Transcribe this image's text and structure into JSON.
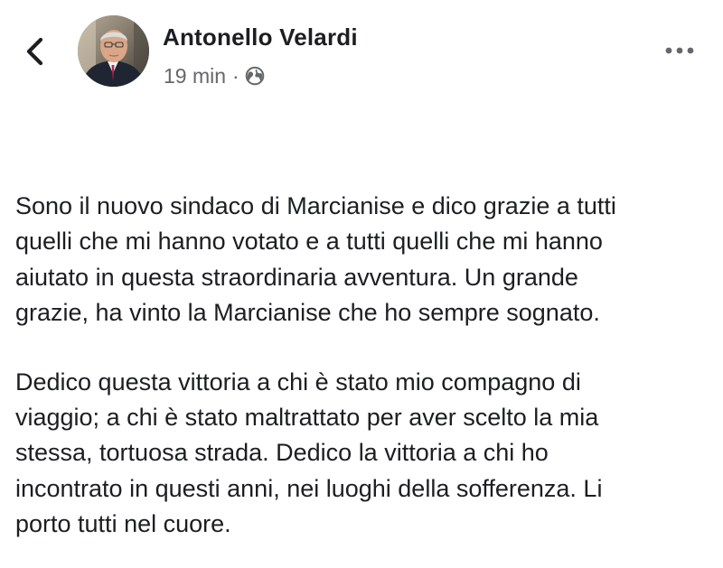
{
  "header": {
    "author_name": "Antonello Velardi",
    "timestamp": "19 min",
    "separator": "·",
    "audience_icon": "globe-icon",
    "back_icon": "chevron-left-icon",
    "more_icon": "more-dots-icon"
  },
  "post": {
    "paragraph1_lines": [
      "Sono il nuovo sindaco di Marcianise e dico grazie a tutti",
      "quelli che mi hanno votato e a tutti quelli che mi hanno",
      "aiutato in questa straordinaria avventura. Un grande",
      "grazie, ha vinto la Marcianise che ho sempre sognato."
    ],
    "paragraph2_lines": [
      "Dedico questa vittoria a chi è stato mio compagno di",
      "viaggio; a chi è stato maltrattato per aver scelto la mia",
      "stessa, tortuosa strada. Dedico la vittoria a chi ho",
      "incontrato in questi anni, nei luoghi della sofferenza. Li",
      "porto tutti nel cuore."
    ]
  },
  "colors": {
    "text": "#1c1e21",
    "secondary_text": "#65676b",
    "background": "#ffffff"
  }
}
